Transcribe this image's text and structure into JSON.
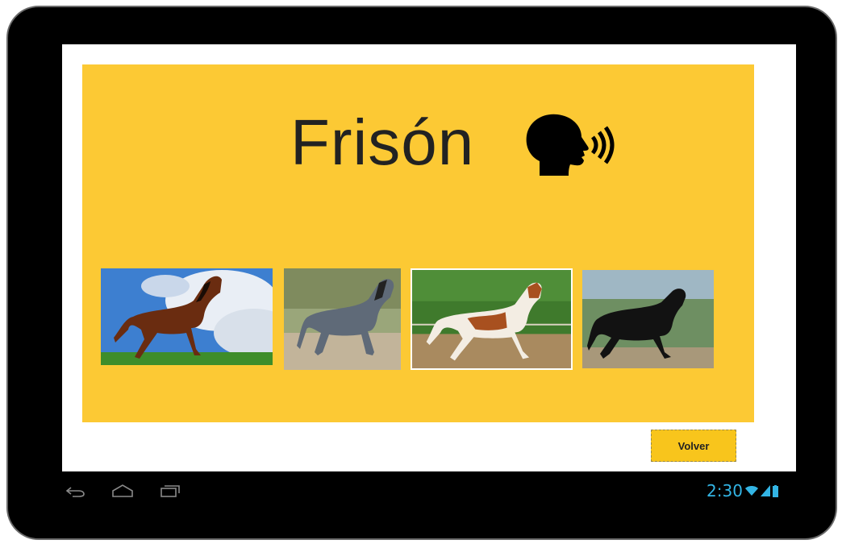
{
  "header": {
    "title": "Frisón",
    "speak_icon": "speaking-head-icon"
  },
  "gallery": {
    "images": [
      {
        "subject": "bay-horse-galloping"
      },
      {
        "subject": "blue-roan-horse"
      },
      {
        "subject": "pinto-horse-running"
      },
      {
        "subject": "black-friesian-horse"
      }
    ]
  },
  "actions": {
    "back_label": "Volver"
  },
  "system_bar": {
    "time": "2:30",
    "icons": [
      "back-icon",
      "home-icon",
      "recent-apps-icon",
      "wifi-icon",
      "signal-icon",
      "battery-icon"
    ]
  },
  "colors": {
    "panel": "#fcc934",
    "button": "#f8c51c",
    "status_accent": "#33b5e5",
    "frame": "#000000"
  }
}
